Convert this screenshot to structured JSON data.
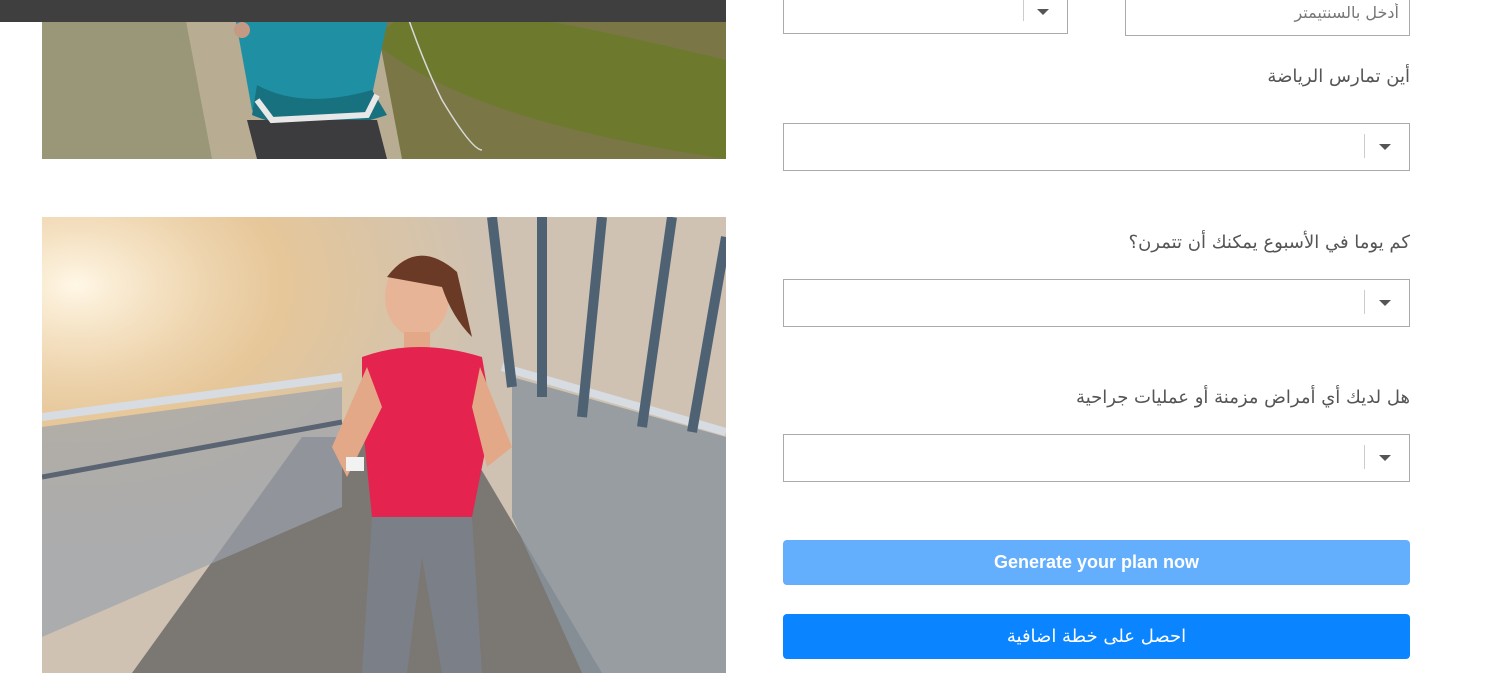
{
  "form": {
    "height_input": {
      "placeholder": "أدخل بالسنتيمتر"
    },
    "questions": [
      {
        "label": "أين تمارس الرياضة",
        "value": ""
      },
      {
        "label": "كم يوما في الأسبوع يمكنك أن تتمرن؟",
        "value": ""
      },
      {
        "label": "هل لديك أي أمراض مزمنة أو عمليات جراحية",
        "value": ""
      }
    ]
  },
  "buttons": {
    "generate_label": "Generate your plan now",
    "extra_plan_label": "احصل على خطة اضافية"
  },
  "colors": {
    "generate_button": "#64aefe",
    "extra_plan_button": "#0a84ff",
    "top_bar": "#3f3f3f"
  },
  "icons": {
    "dropdown": "chevron-down-icon"
  }
}
